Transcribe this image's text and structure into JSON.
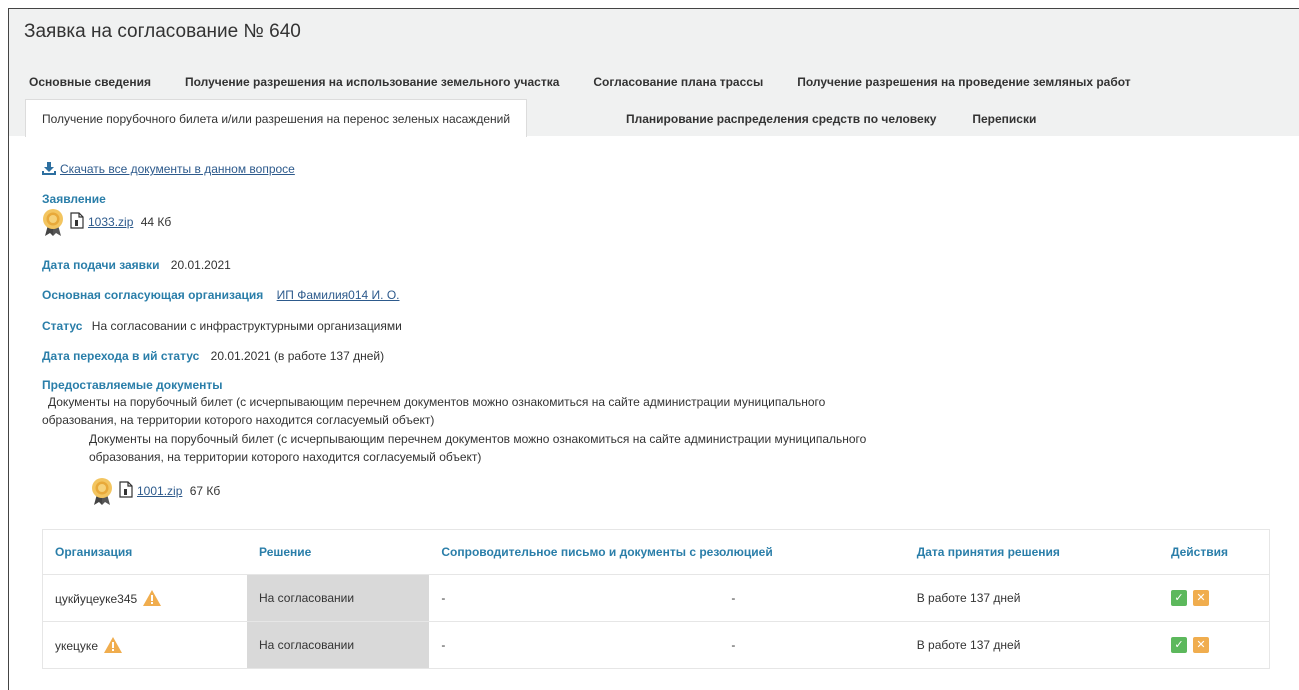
{
  "page": {
    "title": "Заявка на согласование № 640"
  },
  "tabs": {
    "row1": [
      "Основные сведения",
      "Получение разрешения на использование земельного участка",
      "Согласование плана трассы",
      "Получение разрешения на проведение земляных работ"
    ],
    "active": "Получение порубочного билета и/или разрешения на перенос зеленых насаждений",
    "row2": [
      "Планирование распределения средств по человеку",
      "Переписки"
    ]
  },
  "download_all": "Скачать все документы в данном вопросе",
  "application": {
    "label": "Заявление",
    "file": "1033.zip",
    "size": "44 Кб"
  },
  "fields": {
    "submit_date_label": "Дата подачи заявки",
    "submit_date": "20.01.2021",
    "org_label": "Основная согласующая организация",
    "org_value": "ИП Фамилия014 И. О.",
    "status_label": "Статус",
    "status_value": "На согласовании с инфраструктурными организациями",
    "transition_label": "Дата перехода в ий статус",
    "transition_value": "20.01.2021 (в работе 137 дней)"
  },
  "documents": {
    "label": "Предоставляемые документы",
    "group_line1": "Документы на порубочный билет (с исчерпывающим перечнем документов можно ознакомиться на сайте администрации муниципального",
    "group_line2": "образования, на территории которого находится согласуемый объект)",
    "item_line1": "Документы на порубочный билет (с исчерпывающим перечнем документов можно ознакомиться на сайте администрации муниципального",
    "item_line2": "образования, на территории которого находится согласуемый объект)",
    "file": "1001.zip",
    "size": "67 Кб"
  },
  "table": {
    "headers": [
      "Организация",
      "Решение",
      "Сопроводительное письмо и документы с резолюцией",
      "Дата принятия решения",
      "Действия"
    ],
    "rows": [
      {
        "org": "цукйуцеуке345",
        "decision": "На согласовании",
        "col3a": "-",
        "col3b": "-",
        "date": "В работе 137 дней"
      },
      {
        "org": "укецуке",
        "decision": "На согласовании",
        "col3a": "-",
        "col3b": "-",
        "date": "В работе 137 дней"
      }
    ]
  },
  "colors": {
    "accent": "#2a7ea9",
    "link": "#2d5a8c",
    "warning": "#f0ad4e",
    "approve": "#5cb85c"
  }
}
